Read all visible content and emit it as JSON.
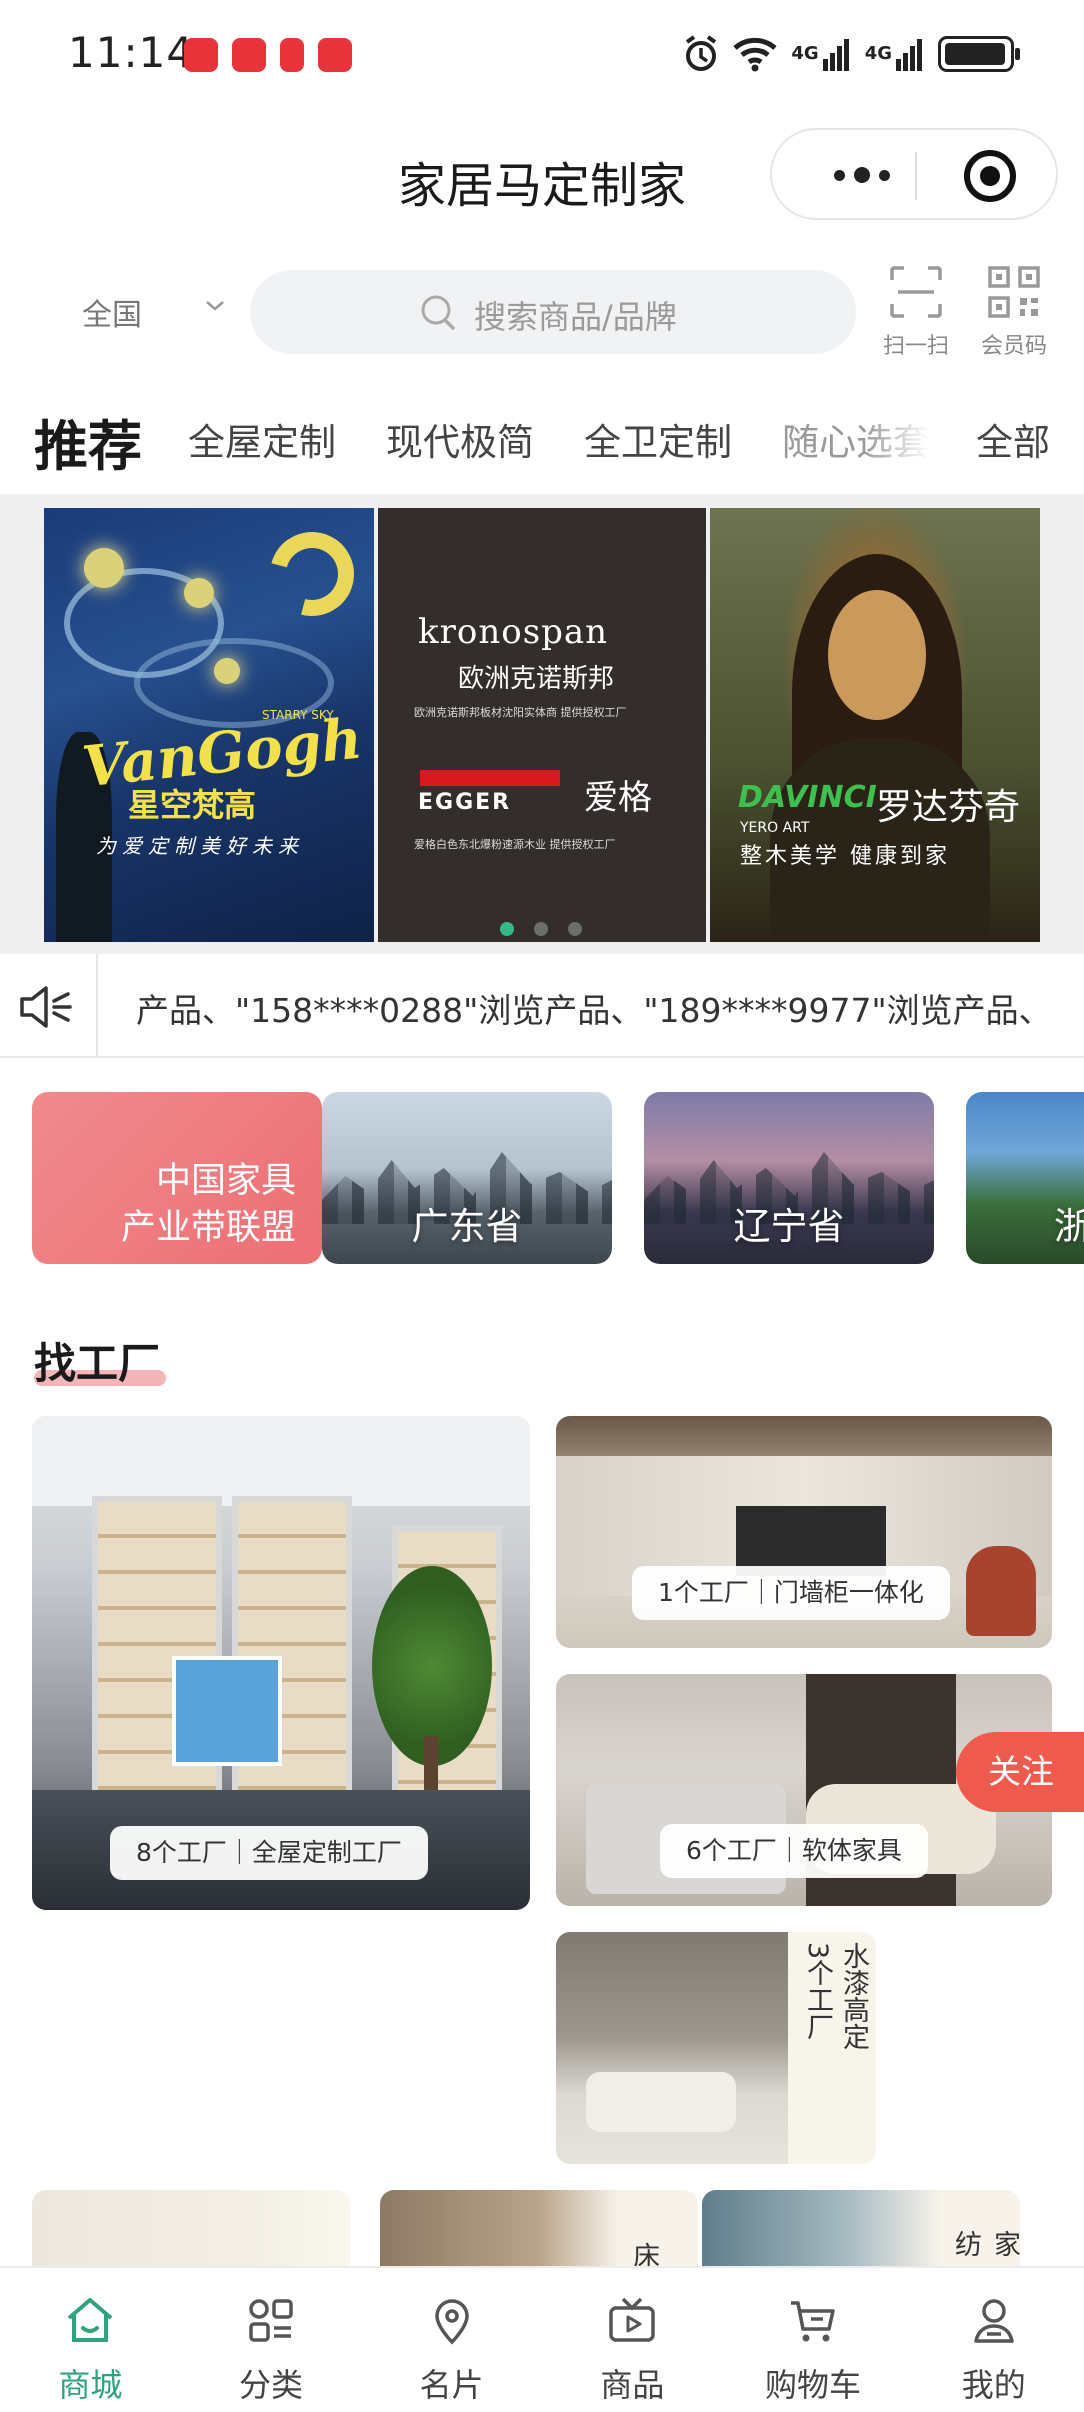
{
  "status_bar": {
    "time": "11:14",
    "network_1": "4G",
    "network_2": "4G"
  },
  "title_bar": {
    "title": "家居马定制家"
  },
  "search": {
    "region": "全国",
    "placeholder": "搜索商品/品牌",
    "scan_label": "扫一扫",
    "member_code_label": "会员码"
  },
  "tabs": {
    "active": "推荐",
    "items": [
      "全屋定制",
      "现代极简",
      "全卫定制",
      "随心选套"
    ],
    "all_label": "全部"
  },
  "banner": {
    "slides": [
      {
        "brand_latin": "VanGogh",
        "brand_cn": "星空梵高",
        "small_text": "STARRY SKY",
        "tagline": "为爱定制美好未来"
      },
      {
        "logo": "kronospan",
        "brand_cn": "欧洲克诺斯邦",
        "desc": "欧洲克诺斯邦板材沈阳实体商 提供授权工厂",
        "logo_2": "EGGER",
        "brand_cn_2": "爱格",
        "desc_2": "爱格白色东北爆粉速源木业 提供授权工厂"
      },
      {
        "brand_latin": "DAVINCI",
        "brand_cn": "罗达芬奇",
        "sub": "YERO ART",
        "tagline": "整木美学 健康到家"
      }
    ],
    "active_index": 0,
    "count": 3
  },
  "notice": {
    "text": "产品、\"158****0288\"浏览产品、\"189****9977\"浏览产品、"
  },
  "regions": [
    {
      "line1": "中国家具",
      "line2": "产业带联盟"
    },
    {
      "label": "广东省"
    },
    {
      "label": "辽宁省"
    },
    {
      "label": "浙"
    }
  ],
  "section": {
    "title": "找工厂"
  },
  "factories": [
    {
      "pill": "8个工厂｜全屋定制工厂"
    },
    {
      "pill": "1个工厂｜门墙柜一体化"
    },
    {
      "pill": "6个工厂｜软体家具"
    },
    {
      "vertical_title": "水漆高定",
      "vertical_count": "3个工厂"
    }
  ],
  "partial_row": {
    "label_2": "床",
    "label_3": "家纺"
  },
  "follow_button": "关注",
  "tabbar": {
    "items": [
      {
        "label": "商城",
        "icon": "home-icon"
      },
      {
        "label": "分类",
        "icon": "category-icon"
      },
      {
        "label": "名片",
        "icon": "location-icon"
      },
      {
        "label": "商品",
        "icon": "video-icon"
      },
      {
        "label": "购物车",
        "icon": "cart-icon"
      },
      {
        "label": "我的",
        "icon": "user-icon"
      }
    ],
    "active": "商城"
  },
  "colors": {
    "accent_green": "#2fa37a",
    "follow_red": "#ee5a4d",
    "pink_card": "#ec6f74",
    "underline_pink": "#f4b5b9"
  }
}
